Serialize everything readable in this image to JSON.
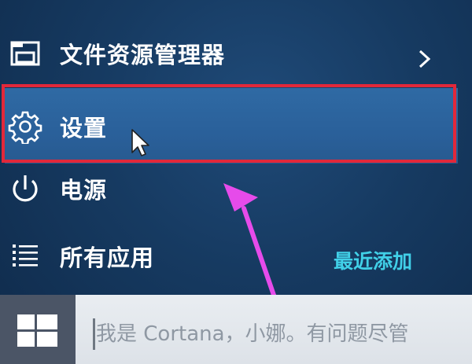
{
  "start_menu": {
    "items": [
      {
        "label": "文件资源管理器",
        "icon": "file-explorer-icon",
        "has_submenu": true
      },
      {
        "label": "设置",
        "icon": "gear-icon",
        "highlighted": true
      },
      {
        "label": "电源",
        "icon": "power-icon"
      },
      {
        "label": "所有应用",
        "icon": "list-icon"
      }
    ],
    "recently_added_label": "最近添加"
  },
  "taskbar": {
    "start_icon": "windows-logo-icon",
    "search_placeholder": "我是 Cortana，小娜。有问题尽管"
  },
  "colors": {
    "menu_background": "#163a61",
    "highlight": "#2f6aa4",
    "annotation_box": "#e2283a",
    "annotation_arrow": "#e64bea",
    "link": "#41d0e8",
    "taskbar": "#4b5566",
    "search_box": "#e9edf1"
  }
}
